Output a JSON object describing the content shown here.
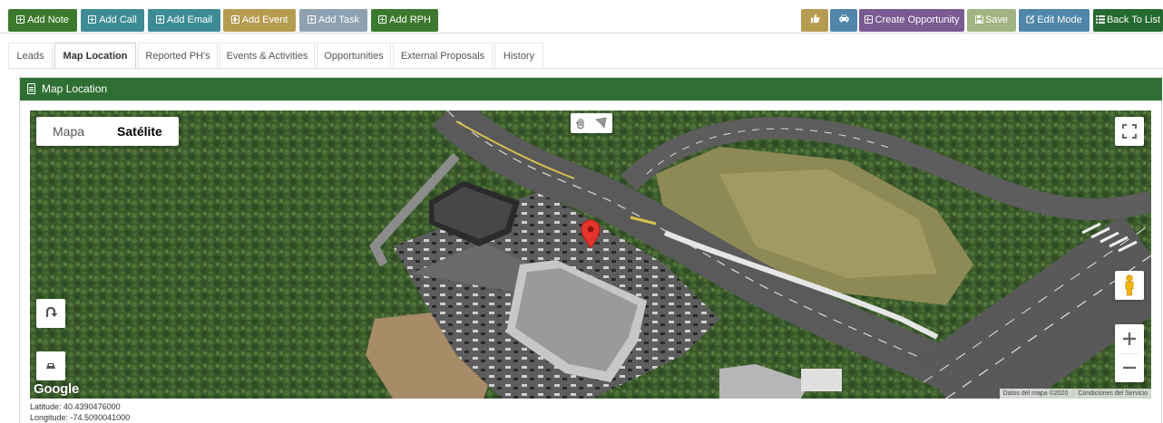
{
  "toolbar": {
    "left_buttons": [
      {
        "label": "Add Note",
        "color": "#3b7a2c"
      },
      {
        "label": "Add Call",
        "color": "#3d8c95"
      },
      {
        "label": "Add Email",
        "color": "#3d8c95"
      },
      {
        "label": "Add Event",
        "color": "#b69b4f"
      },
      {
        "label": "Add Task",
        "color": "#8ea1b0"
      },
      {
        "label": "Add RPH",
        "color": "#3b7a2c"
      }
    ],
    "thumbs_icon": "thumbs-up-icon",
    "car_icon": "car-icon",
    "create_opportunity": "Create Opportunity",
    "save": "Save",
    "edit_mode": "Edit Mode",
    "back_to_list": "Back To List"
  },
  "tabs": [
    {
      "label": "Leads",
      "active": false
    },
    {
      "label": "Map Location",
      "active": true
    },
    {
      "label": "Reported PH's",
      "active": false
    },
    {
      "label": "Events & Activities",
      "active": false
    },
    {
      "label": "Opportunities",
      "active": false
    },
    {
      "label": "External Proposals",
      "active": false
    },
    {
      "label": "History",
      "active": false
    }
  ],
  "panel": {
    "title": "Map Location",
    "header_color": "#2f6f34"
  },
  "map": {
    "type_control": {
      "map": "Mapa",
      "satellite": "Satélite",
      "selected": "Satélite"
    },
    "logo": "Google",
    "attribution": "Datos del mapa ©2020",
    "terms": "Condiciones del Servicio",
    "marker_color": "#e8332b"
  },
  "coordinates": {
    "latitude": "Latitude: 40.4390476000",
    "longitude": "Longitude: -74.5090041000"
  }
}
